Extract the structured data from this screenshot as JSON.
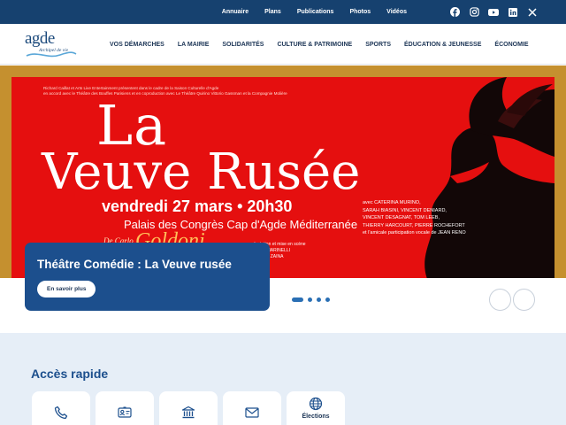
{
  "utility_links": [
    "Annuaire",
    "Plans",
    "Publications",
    "Photos",
    "Vidéos"
  ],
  "social_icons": [
    "facebook-icon",
    "instagram-icon",
    "youtube-icon",
    "linkedin-icon",
    "x-icon"
  ],
  "logo": {
    "name": "agde",
    "tagline": "Archipel de vie"
  },
  "nav": [
    "VOS DÉMARCHES",
    "LA MAIRIE",
    "SOLIDARITÉS",
    "CULTURE & PATRIMOINE",
    "SPORTS",
    "ÉDUCATION & JEUNESSE",
    "ÉCONOMIE"
  ],
  "hero": {
    "poster": {
      "credits_line1": "Richard Caillat et Arts Live Entertainment présentent dans le cadre de la Saison Culturelle d'Agde",
      "credits_line2": "en accord avec le Théâtre des Bouffes Parisiens et en coproduction avec Le Théâtre Quirino Vittorio Gassman et la Compagnie Molière",
      "title_line1": "La",
      "title_line2": "Veuve Rusée",
      "date": "vendredi 27 mars • 20h30",
      "venue": "Palais des Congrès Cap d'Agde Méditerranée",
      "author_prefix": "De Carlo",
      "author": "Goldoni",
      "staging_line1": "adaptation et mise en scène",
      "staging_line2": "CARLO MARINELLI",
      "staging_line3": "VALERIO ZAINA",
      "cast": [
        "avec CATERINA MURINO,",
        "SARAH BIASINI, VINCENT DENIARD,",
        "VINCENT DESAGNAT, TOM LEEB,",
        "THIERRY HARCOURT, PIERRE ROCHEFORT",
        "et l'amicale participation vocale de JEAN RENO"
      ]
    },
    "caption_title": "Théâtre Comédie : La Veuve rusée",
    "cta_label": "En savoir plus",
    "slide_count": 4,
    "active_slide": 1
  },
  "quick_access": {
    "title": "Accès rapide",
    "tiles": [
      {
        "icon": "phone-icon",
        "label": ""
      },
      {
        "icon": "id-card-icon",
        "label": ""
      },
      {
        "icon": "town-hall-icon",
        "label": ""
      },
      {
        "icon": "mail-icon",
        "label": ""
      },
      {
        "icon": "globe-icon",
        "label": "Élections"
      }
    ]
  },
  "colors": {
    "navy": "#16416f",
    "brand_blue": "#1c4f8d",
    "poster_red": "#e50f0f",
    "poster_gold": "#c5902f",
    "light_bg": "#e6eef7"
  }
}
